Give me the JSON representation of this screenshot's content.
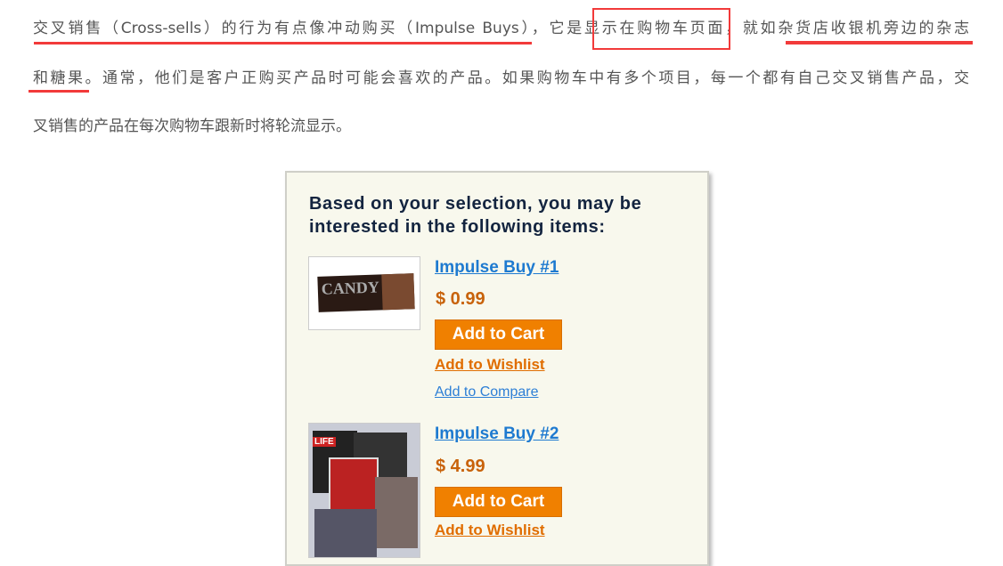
{
  "article": {
    "lines": [
      "交叉销售（Cross-sells）的行为有点像冲动购买（Impulse Buys），它是显示在购物车页面，就如杂货店收银机旁边的杂志",
      "和糖果。通常，他们是客户正购买产品时可能会喜欢的产品。如果购物车中有多个项目，每一个都有自己交叉销售产品，交",
      "叉销售的产品在每次购物车跟新时将轮流显示。"
    ],
    "annotation_color": "#f23a3a"
  },
  "panel": {
    "heading": "Based on your selection, you may be interested in the following items:",
    "items": [
      {
        "name": "Impulse Buy #1",
        "price": "$ 0.99",
        "add_to_cart": "Add to Cart",
        "wishlist": "Add to Wishlist",
        "compare": "Add to Compare",
        "image": "candy-bar",
        "image_text": "CANDY"
      },
      {
        "name": "Impulse Buy #2",
        "price": "$ 4.99",
        "add_to_cart": "Add to Cart",
        "wishlist": "Add to Wishlist",
        "image": "magazines",
        "image_text": "LIFE"
      }
    ]
  },
  "colors": {
    "link": "#1e7ad0",
    "price": "#c8620a",
    "button": "#f08000",
    "panel_bg": "#f8f8ed"
  }
}
